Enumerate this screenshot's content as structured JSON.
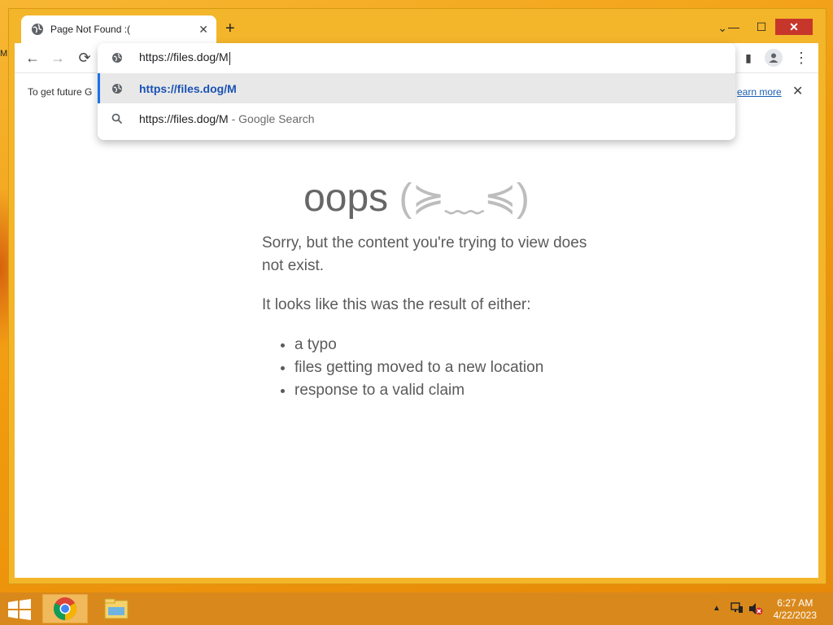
{
  "desktop": {
    "edge_letter": "M"
  },
  "window": {
    "controls": {
      "minimize": "—",
      "maximize": "☐",
      "close": "✕"
    }
  },
  "tab": {
    "title": "Page Not Found :(",
    "close": "✕",
    "new_tab": "+",
    "dropdown": "⌄"
  },
  "toolbar": {
    "back": "←",
    "forward": "→",
    "reload": "⟳",
    "menu": "⋮",
    "side_panel": "▮"
  },
  "infobar": {
    "text": "To get future G",
    "link": "earn more",
    "close": "✕"
  },
  "omnibox": {
    "input_value": "https://files.dog/M",
    "suggestions": [
      {
        "text": "https://files.dog/M",
        "icon": "globe-icon"
      },
      {
        "text": "https://files.dog/M",
        "suffix": " - Google Search",
        "icon": "search-icon"
      }
    ]
  },
  "page": {
    "heading": "oops",
    "face": "(≽﹏≼)",
    "msg1": "Sorry, but the content you're trying to view does not exist.",
    "msg2": "It looks like this was the result of either:",
    "reasons": [
      "a typo",
      "files getting moved to a new location",
      "response to a valid claim"
    ]
  },
  "taskbar": {
    "tray_arrow": "▲",
    "time": "6:27 AM",
    "date": "4/22/2023"
  },
  "colors": {
    "accent": "#1a73e8",
    "close_button": "#c7362b",
    "taskbar": "#d9891b"
  }
}
